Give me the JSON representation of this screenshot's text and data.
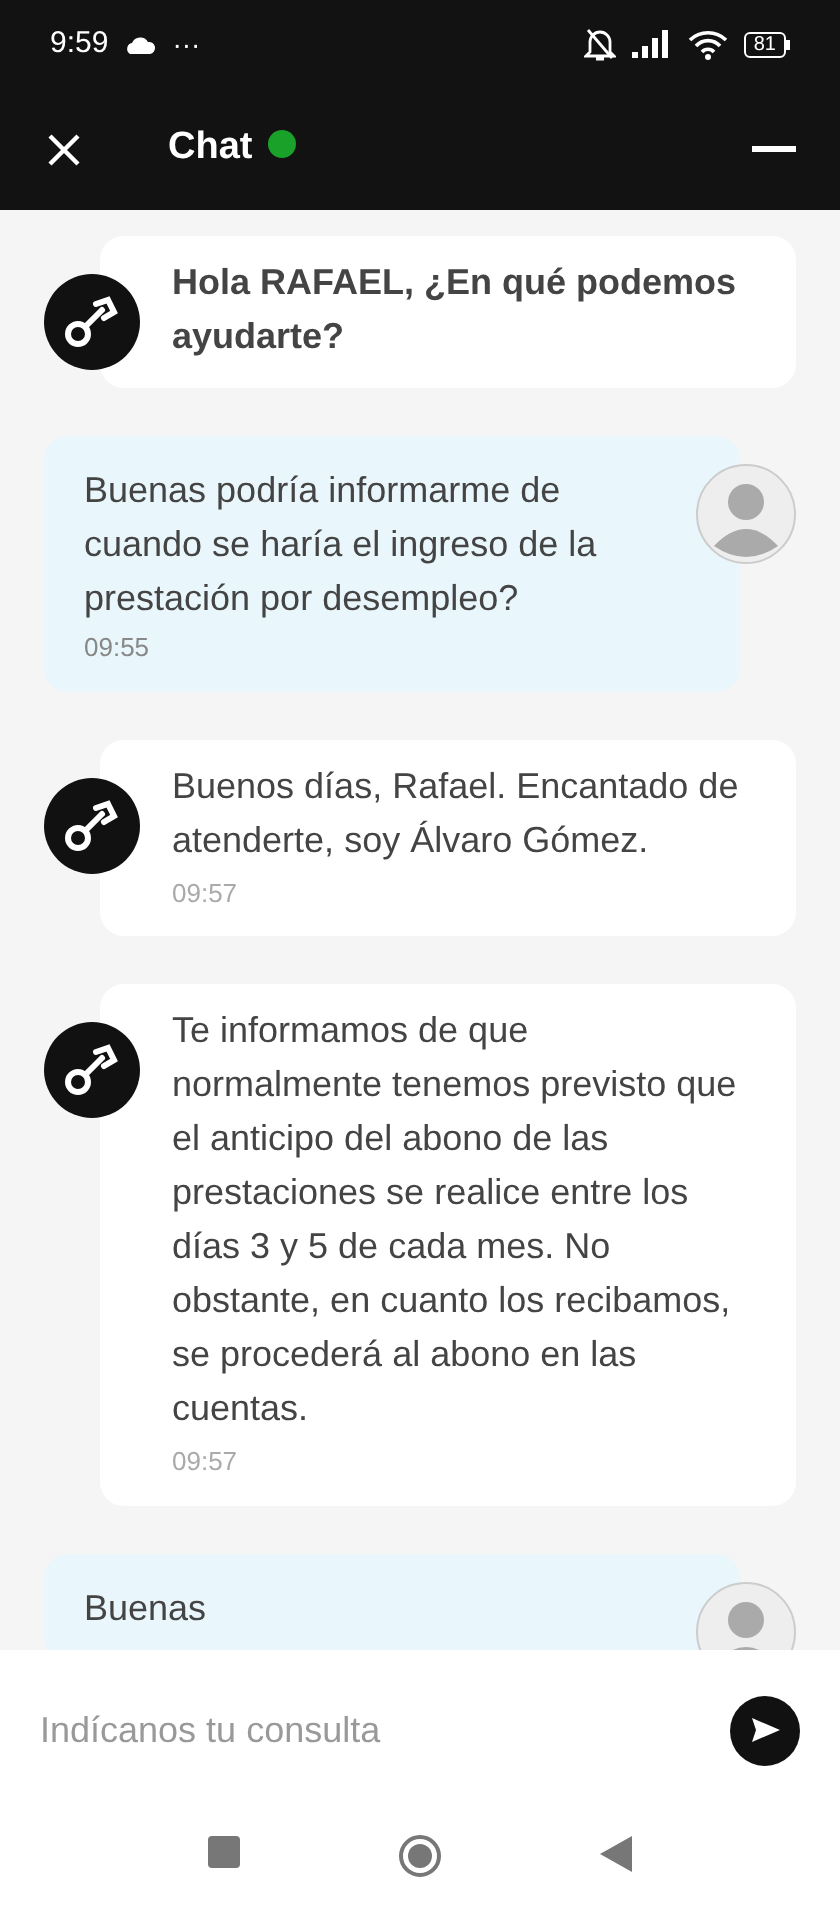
{
  "status_bar": {
    "time": "9:59",
    "more": "···",
    "battery": "81"
  },
  "header": {
    "title": "Chat",
    "online": true
  },
  "messages": [
    {
      "kind": "agent",
      "text": "Hola RAFAEL, ¿En qué podemos ayudarte?",
      "bold": true
    },
    {
      "kind": "user",
      "text": "Buenas podría informarme de cuando se haría el ingreso de la prestación por desempleo?",
      "time": "09:55",
      "bold": false
    },
    {
      "kind": "agent",
      "text": "Buenos días, Rafael. Encantado de atenderte, soy Álvaro Gómez.",
      "time": "09:57",
      "bold": false
    },
    {
      "kind": "agent",
      "text": "Te informamos de que normalmente tenemos previsto que el anticipo del abono de las prestaciones se realice entre los días 3 y 5 de cada mes. No obstante, en cuanto los recibamos, se procederá al abono en las cuentas.",
      "time": "09:57",
      "bold": false
    },
    {
      "kind": "user",
      "text": "Buenas",
      "bold": false
    }
  ],
  "composer": {
    "placeholder": "Indícanos tu consulta"
  }
}
